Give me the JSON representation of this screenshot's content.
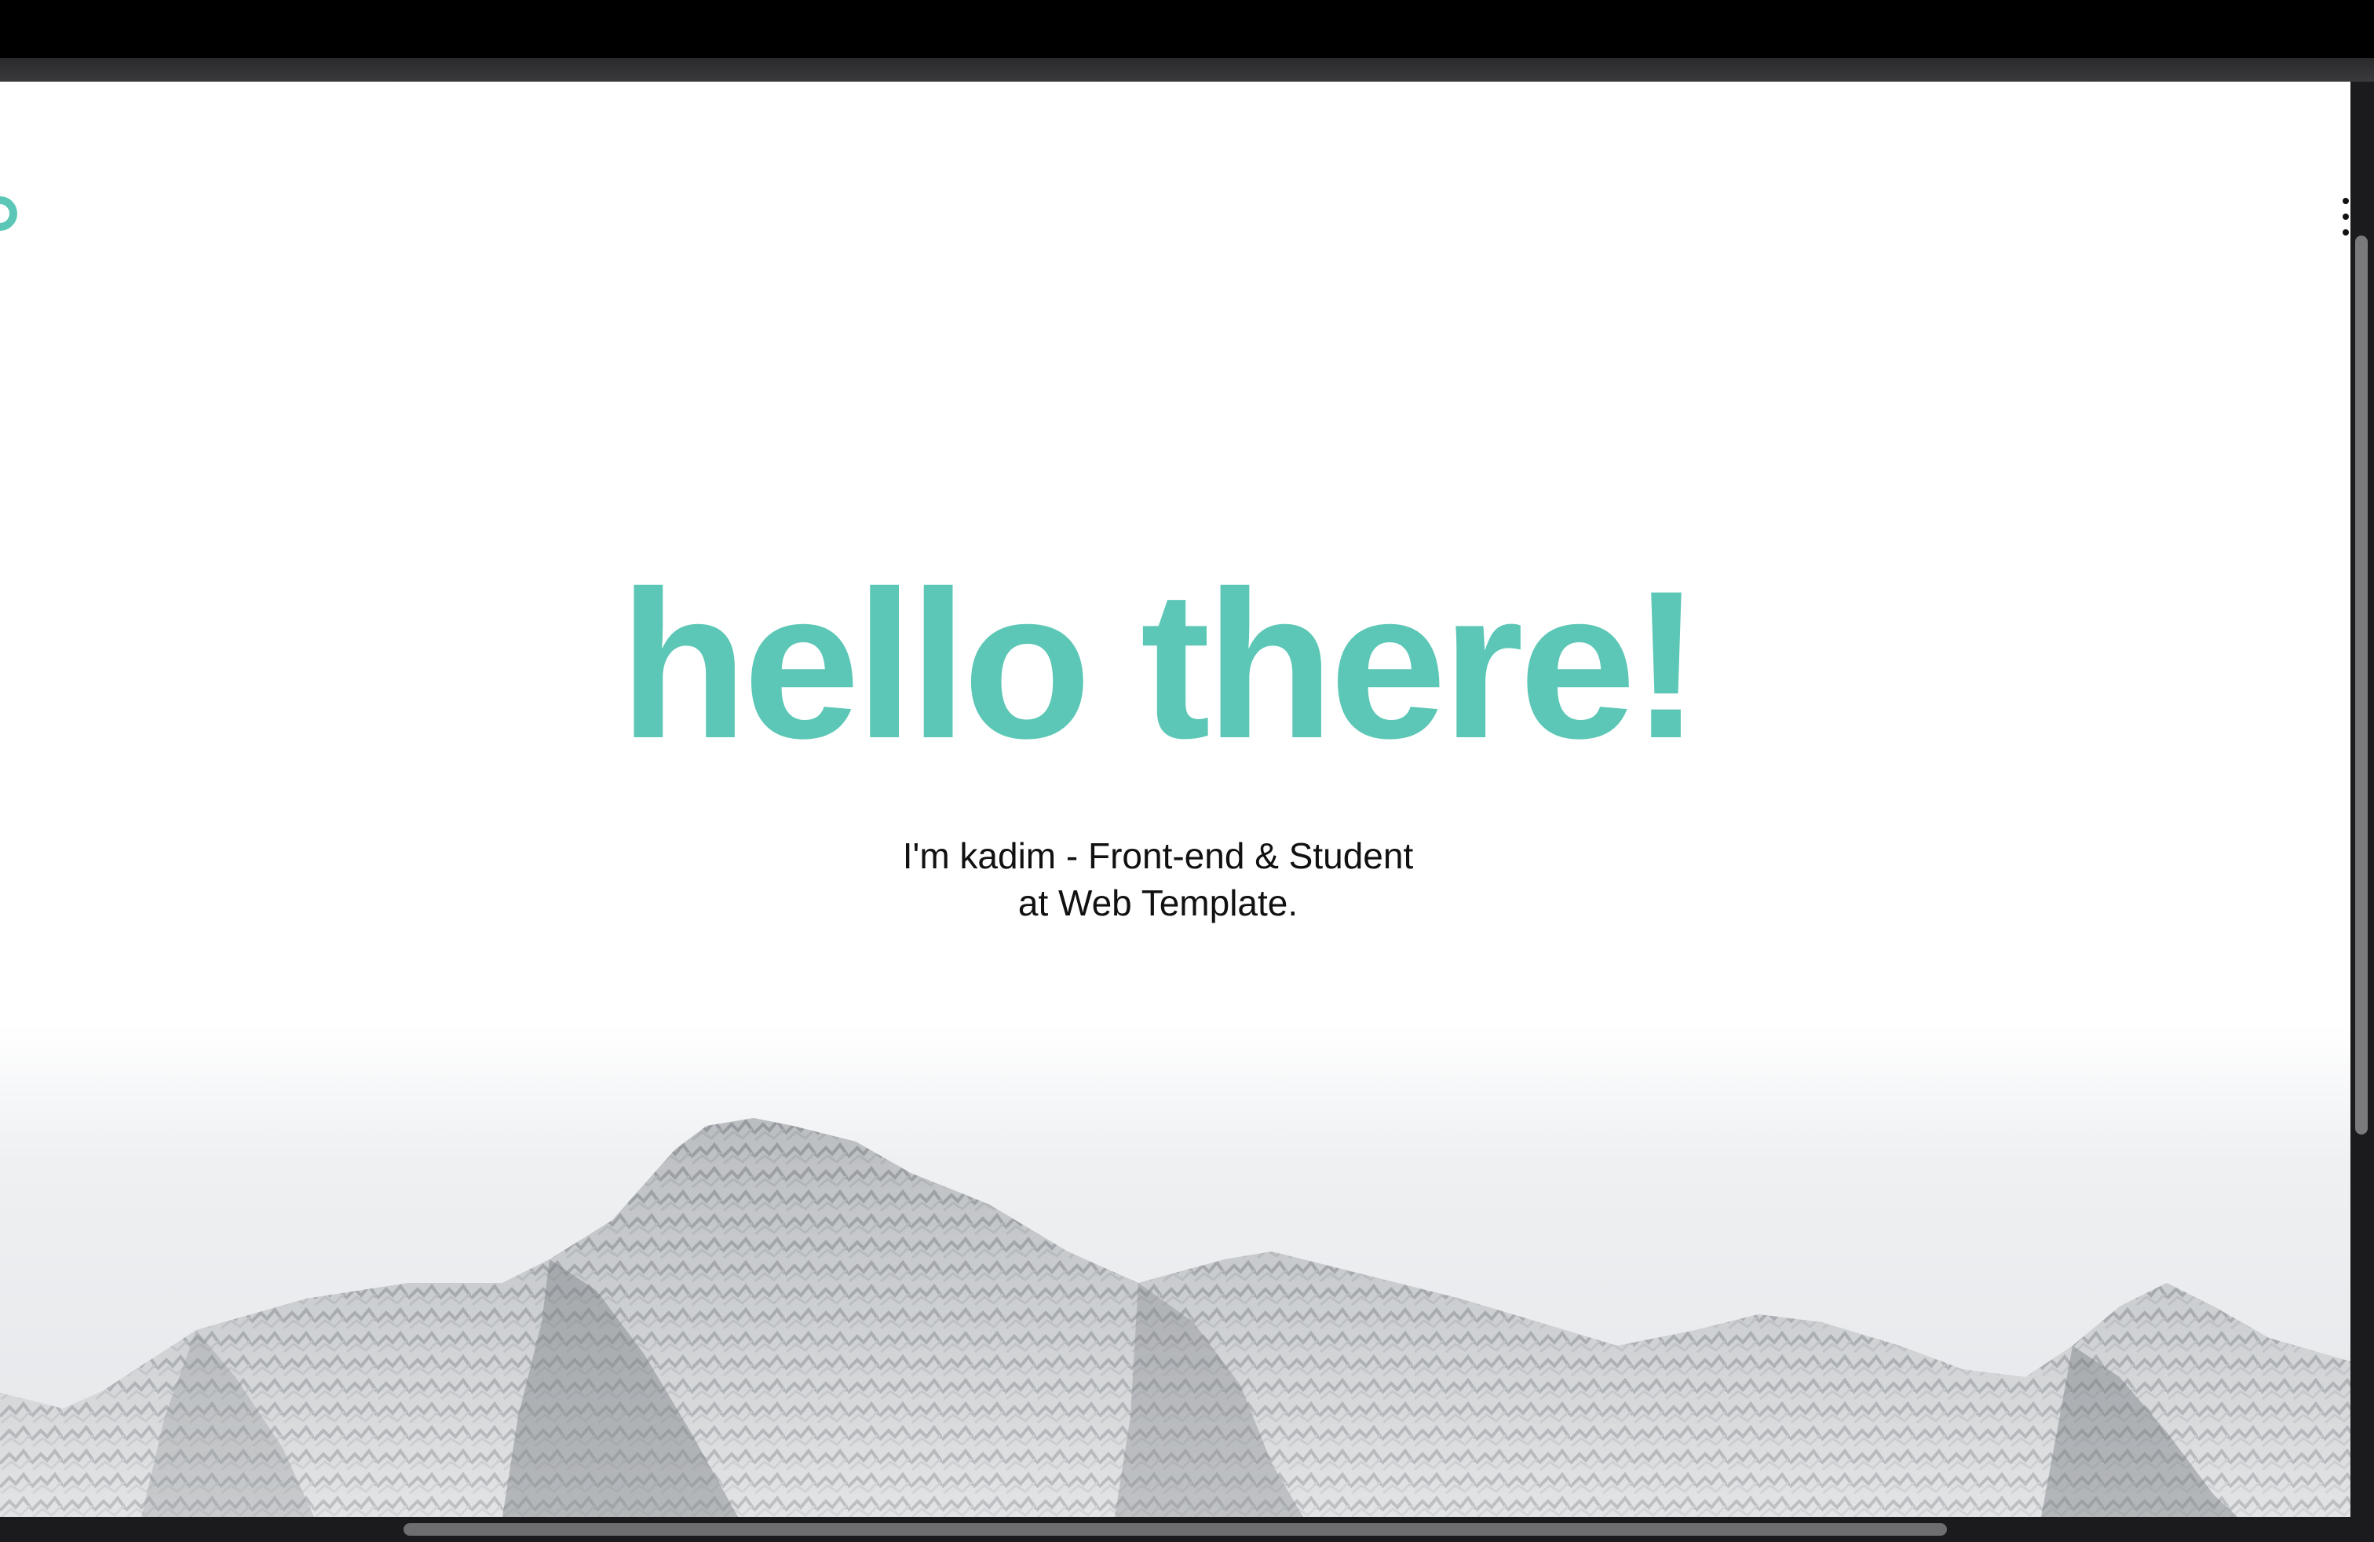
{
  "hero": {
    "title": "hello there!",
    "subtitle_line1": "I'm kadim - Front-end & Student",
    "subtitle_line2": "at Web Template."
  },
  "colors": {
    "accent": "#5cc7b6",
    "page_background": "#ffffff",
    "text": "#111111"
  },
  "icons": {
    "menu": "vertical-dots-menu-icon",
    "logo": "logo-icon"
  }
}
